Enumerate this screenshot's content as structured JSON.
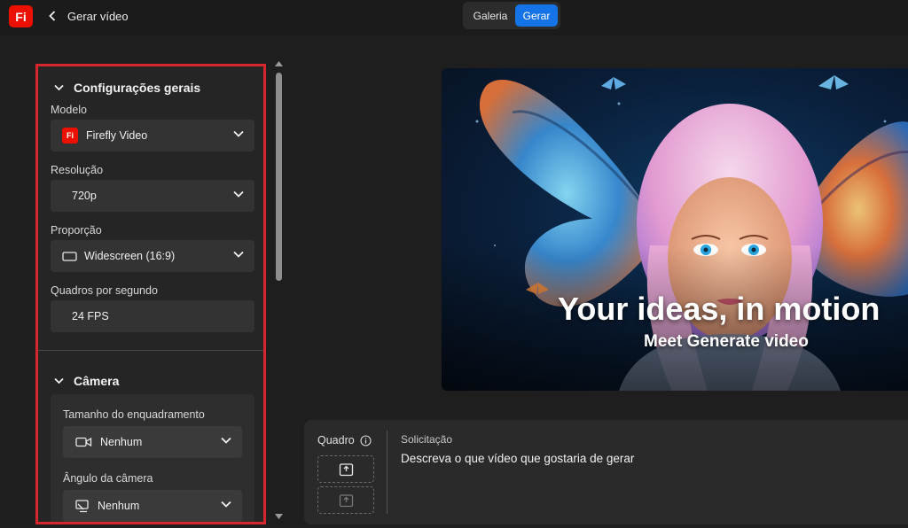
{
  "app": {
    "logo_text": "Fi",
    "brand_color": "#eb1000",
    "accent_color": "#1473e6"
  },
  "header": {
    "back_icon": "chevron-left-icon",
    "title": "Gerar vídeo",
    "tabs": [
      {
        "label": "Galeria",
        "active": false
      },
      {
        "label": "Gerar",
        "active": true
      }
    ]
  },
  "panel": {
    "general": {
      "title": "Configurações gerais",
      "model": {
        "label": "Modelo",
        "value": "Firefly Video",
        "icon": "firefly-logo-icon"
      },
      "resolution": {
        "label": "Resolução",
        "value": "720p"
      },
      "aspect": {
        "label": "Proporção",
        "value": "Widescreen (16:9)",
        "icon": "widescreen-icon"
      },
      "fps": {
        "label": "Quadros por segundo",
        "value": "24 FPS"
      }
    },
    "camera": {
      "title": "Câmera",
      "framing": {
        "label": "Tamanho do enquadramento",
        "value": "Nenhum",
        "icon": "video-camera-icon"
      },
      "angle": {
        "label": "Ângulo da câmera",
        "value": "Nenhum",
        "icon": "camera-angle-icon"
      }
    }
  },
  "preview": {
    "headline": "Your ideas, in motion",
    "subline": "Meet Generate video"
  },
  "prompt": {
    "frame_label": "Quadro",
    "info_icon": "info-icon",
    "upload_icon": "upload-icon",
    "label": "Solicitação",
    "placeholder": "Descreva o que vídeo que gostaria de gerar"
  }
}
